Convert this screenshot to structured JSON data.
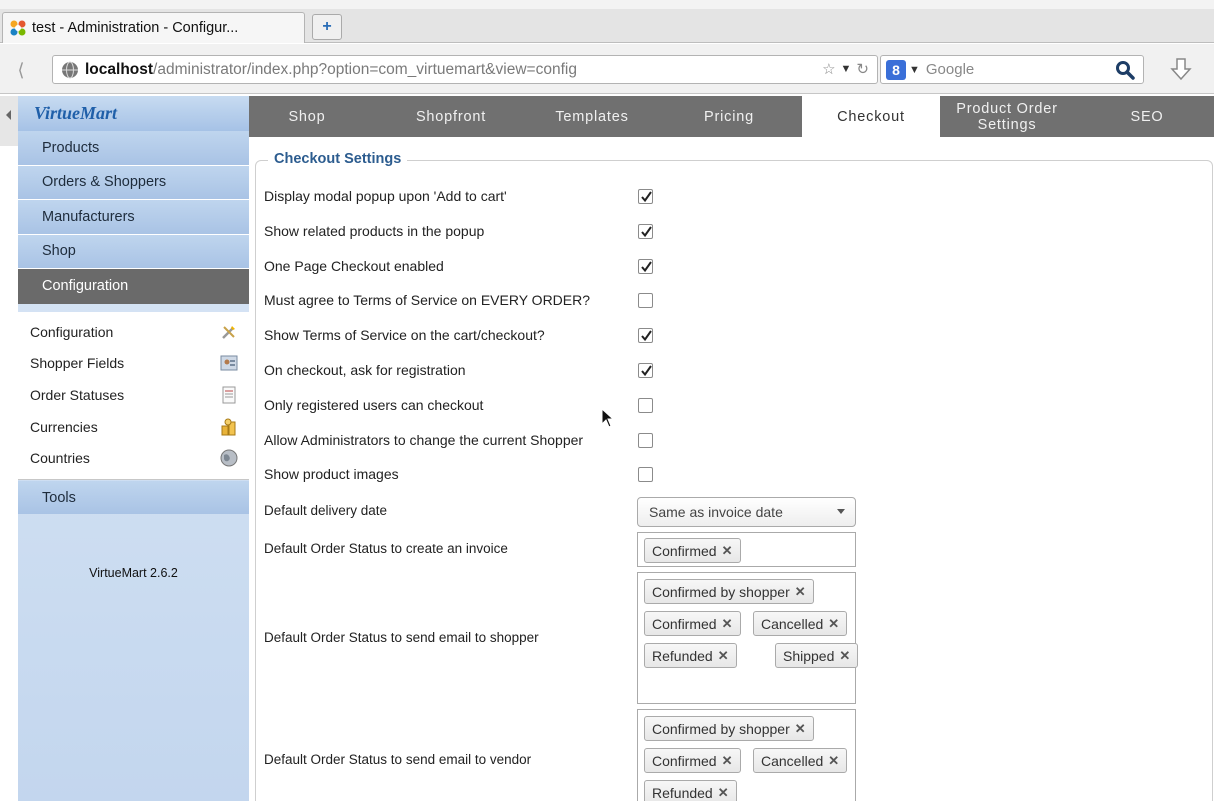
{
  "browser": {
    "tab_title": "test - Administration - Configur...",
    "new_tab_symbol": "+",
    "back_symbol": "⟨",
    "url_host": "localhost",
    "url_path": "/administrator/index.php?option=com_virtuemart&view=config",
    "search_placeholder": "Google",
    "search_engine_letter": "8"
  },
  "sidebar": {
    "logo_text": "VirtueMart",
    "menu": [
      {
        "label": "Products"
      },
      {
        "label": "Orders & Shoppers"
      },
      {
        "label": "Manufacturers"
      },
      {
        "label": "Shop"
      },
      {
        "label": "Configuration",
        "active": true
      }
    ],
    "submenu": [
      {
        "label": "Configuration",
        "icon": "tools-icon"
      },
      {
        "label": "Shopper Fields",
        "icon": "user-fields-icon"
      },
      {
        "label": "Order Statuses",
        "icon": "document-icon"
      },
      {
        "label": "Currencies",
        "icon": "coins-icon"
      },
      {
        "label": "Countries",
        "icon": "globe-icon"
      }
    ],
    "tools_label": "Tools",
    "version": "VirtueMart 2.6.2"
  },
  "tabs": [
    {
      "label": "Shop",
      "active": false
    },
    {
      "label": "Shopfront",
      "active": false
    },
    {
      "label": "Templates",
      "active": false
    },
    {
      "label": "Pricing",
      "active": false
    },
    {
      "label": "Checkout",
      "active": true
    },
    {
      "label": "Product Order Settings",
      "active": false
    },
    {
      "label": "SEO",
      "active": false
    }
  ],
  "checkout": {
    "legend": "Checkout Settings",
    "options": [
      {
        "label": "Display modal popup upon 'Add to cart'",
        "checked": true
      },
      {
        "label": "Show related products in the popup",
        "checked": true
      },
      {
        "label": "One Page Checkout enabled",
        "checked": true
      },
      {
        "label": "Must agree to Terms of Service on EVERY ORDER?",
        "checked": false
      },
      {
        "label": "Show Terms of Service on the cart/checkout?",
        "checked": true
      },
      {
        "label": "On checkout, ask for registration",
        "checked": true
      },
      {
        "label": "Only registered users can checkout",
        "checked": false
      },
      {
        "label": "Allow Administrators to change the current Shopper",
        "checked": false
      },
      {
        "label": "Show product images",
        "checked": false
      }
    ],
    "delivery_date_label": "Default delivery date",
    "delivery_date_value": "Same as invoice date",
    "invoice_status_label": "Default Order Status to create an invoice",
    "invoice_status_chips": [
      "Confirmed"
    ],
    "shopper_email_label": "Default Order Status to send email to shopper",
    "shopper_email_chips": [
      "Confirmed by shopper",
      "Confirmed",
      "Cancelled",
      "Refunded",
      "Shipped"
    ],
    "vendor_email_label": "Default Order Status to send email to vendor",
    "vendor_email_chips": [
      "Confirmed by shopper",
      "Confirmed",
      "Cancelled",
      "Refunded"
    ],
    "chip_remove_symbol": "✕"
  }
}
